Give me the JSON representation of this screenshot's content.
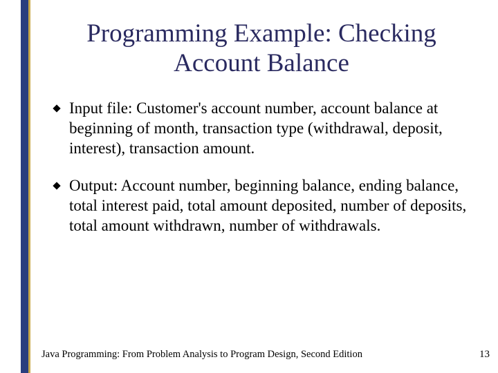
{
  "slide": {
    "title": "Programming Example: Checking Account Balance",
    "bullets": [
      "Input file: Customer's account number, account balance at beginning of month, transaction type (withdrawal, deposit, interest), transaction amount.",
      "Output: Account number, beginning balance, ending balance, total interest paid, total amount deposited, number of deposits, total amount withdrawn, number of withdrawals."
    ],
    "footer": "Java Programming: From Problem Analysis to Program Design, Second Edition",
    "page_number": "13"
  },
  "colors": {
    "rail": "#2a3e7e",
    "gold": "#c9a94a",
    "title": "#2a2a60"
  }
}
